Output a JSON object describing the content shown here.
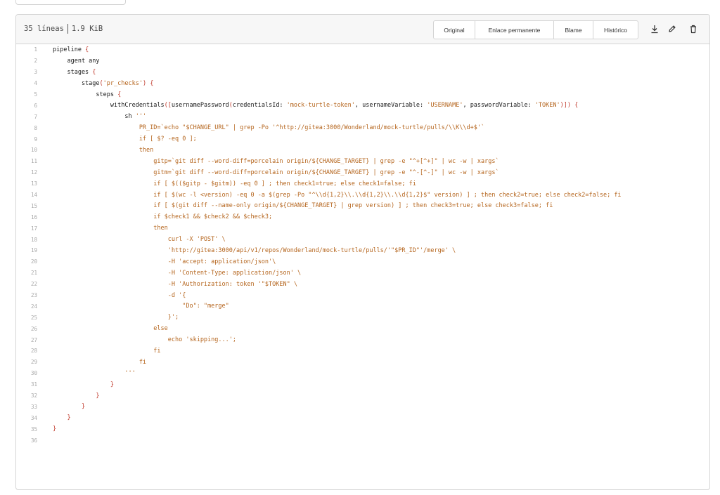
{
  "header": {
    "lines": "35 líneas",
    "size": "1.9 KiB",
    "buttons": [
      {
        "name": "raw-button",
        "label": "Original"
      },
      {
        "name": "permalink-button",
        "label": "Enlace permanente"
      },
      {
        "name": "blame-button",
        "label": "Blame"
      },
      {
        "name": "history-button",
        "label": "Histórico"
      }
    ],
    "icons": [
      "download-icon",
      "edit-icon",
      "delete-icon"
    ]
  },
  "code": [
    [
      [
        "k",
        "pipeline "
      ],
      [
        "b",
        "{"
      ]
    ],
    [
      [
        "k",
        "    agent any"
      ]
    ],
    [
      [
        "k",
        "    stages "
      ],
      [
        "b",
        "{"
      ]
    ],
    [
      [
        "k",
        "        stage"
      ],
      [
        "b",
        "("
      ],
      [
        "s",
        "'pr_checks'"
      ],
      [
        "b",
        ")"
      ],
      [
        "k",
        " "
      ],
      [
        "b",
        "{"
      ]
    ],
    [
      [
        "k",
        "            steps "
      ],
      [
        "b",
        "{"
      ]
    ],
    [
      [
        "k",
        "                withCredentials"
      ],
      [
        "b",
        "(["
      ],
      [
        "k",
        "usernamePassword"
      ],
      [
        "b",
        "("
      ],
      [
        "k",
        "credentialsId: "
      ],
      [
        "s",
        "'mock-turtle-token'"
      ],
      [
        "k",
        ", usernameVariable: "
      ],
      [
        "s",
        "'USERNAME'"
      ],
      [
        "k",
        ", passwordVariable: "
      ],
      [
        "s",
        "'TOKEN'"
      ],
      [
        "b",
        ")])"
      ],
      [
        "k",
        " "
      ],
      [
        "b",
        "{"
      ]
    ],
    [
      [
        "k",
        "                    sh "
      ],
      [
        "s",
        "'''"
      ]
    ],
    [
      [
        "s",
        "                        PR_ID=`echo \"$CHANGE_URL\" | grep -Po '^http://gitea:3000/Wonderland/mock-turtle/pulls/\\\\K\\\\d+$'`"
      ]
    ],
    [
      [
        "s",
        "                        if [ $? -eq 0 ];"
      ]
    ],
    [
      [
        "s",
        "                        then"
      ]
    ],
    [
      [
        "s",
        "                            gitp=`git diff --word-diff=porcelain origin/${CHANGE_TARGET} | grep -e \"^+[^+]\" | wc -w | xargs`"
      ]
    ],
    [
      [
        "s",
        "                            gitm=`git diff --word-diff=porcelain origin/${CHANGE_TARGET} | grep -e \"^-[^-]\" | wc -w | xargs`"
      ]
    ],
    [
      [
        "s",
        "                            if [ $(($gitp - $gitm)) -eq 0 ] ; then check1=true; else check1=false; fi"
      ]
    ],
    [
      [
        "s",
        "                            if [ $(wc -l <version) -eq 0 -a $(grep -Po \"^\\\\d{1,2}\\\\.\\\\d{1,2}\\\\.\\\\d{1,2}$\" version) ] ; then check2=true; else check2=false; fi"
      ]
    ],
    [
      [
        "s",
        "                            if [ $(git diff --name-only origin/${CHANGE_TARGET} | grep version) ] ; then check3=true; else check3=false; fi"
      ]
    ],
    [
      [
        "s",
        "                            if $check1 && $check2 && $check3;"
      ]
    ],
    [
      [
        "s",
        "                            then"
      ]
    ],
    [
      [
        "s",
        "                                curl -X 'POST' \\"
      ]
    ],
    [
      [
        "s",
        "                                'http://gitea:3000/api/v1/repos/Wonderland/mock-turtle/pulls/'\"$PR_ID\"'/merge' \\"
      ]
    ],
    [
      [
        "s",
        "                                -H 'accept: application/json'\\"
      ]
    ],
    [
      [
        "s",
        "                                -H 'Content-Type: application/json' \\"
      ]
    ],
    [
      [
        "s",
        "                                -H 'Authorization: token '\"$TOKEN\" \\"
      ]
    ],
    [
      [
        "s",
        "                                -d '{"
      ]
    ],
    [
      [
        "s",
        "                                    \"Do\": \"merge\""
      ]
    ],
    [
      [
        "s",
        "                                }';"
      ]
    ],
    [
      [
        "s",
        "                            else"
      ]
    ],
    [
      [
        "s",
        "                                echo 'skipping...';"
      ]
    ],
    [
      [
        "s",
        "                            fi"
      ]
    ],
    [
      [
        "s",
        "                        fi"
      ]
    ],
    [
      [
        "s",
        "                    '''"
      ]
    ],
    [
      [
        "b",
        "                }"
      ]
    ],
    [
      [
        "b",
        "            }"
      ]
    ],
    [
      [
        "b",
        "        }"
      ]
    ],
    [
      [
        "b",
        "    }"
      ]
    ],
    [
      [
        "b",
        "}"
      ]
    ],
    []
  ]
}
